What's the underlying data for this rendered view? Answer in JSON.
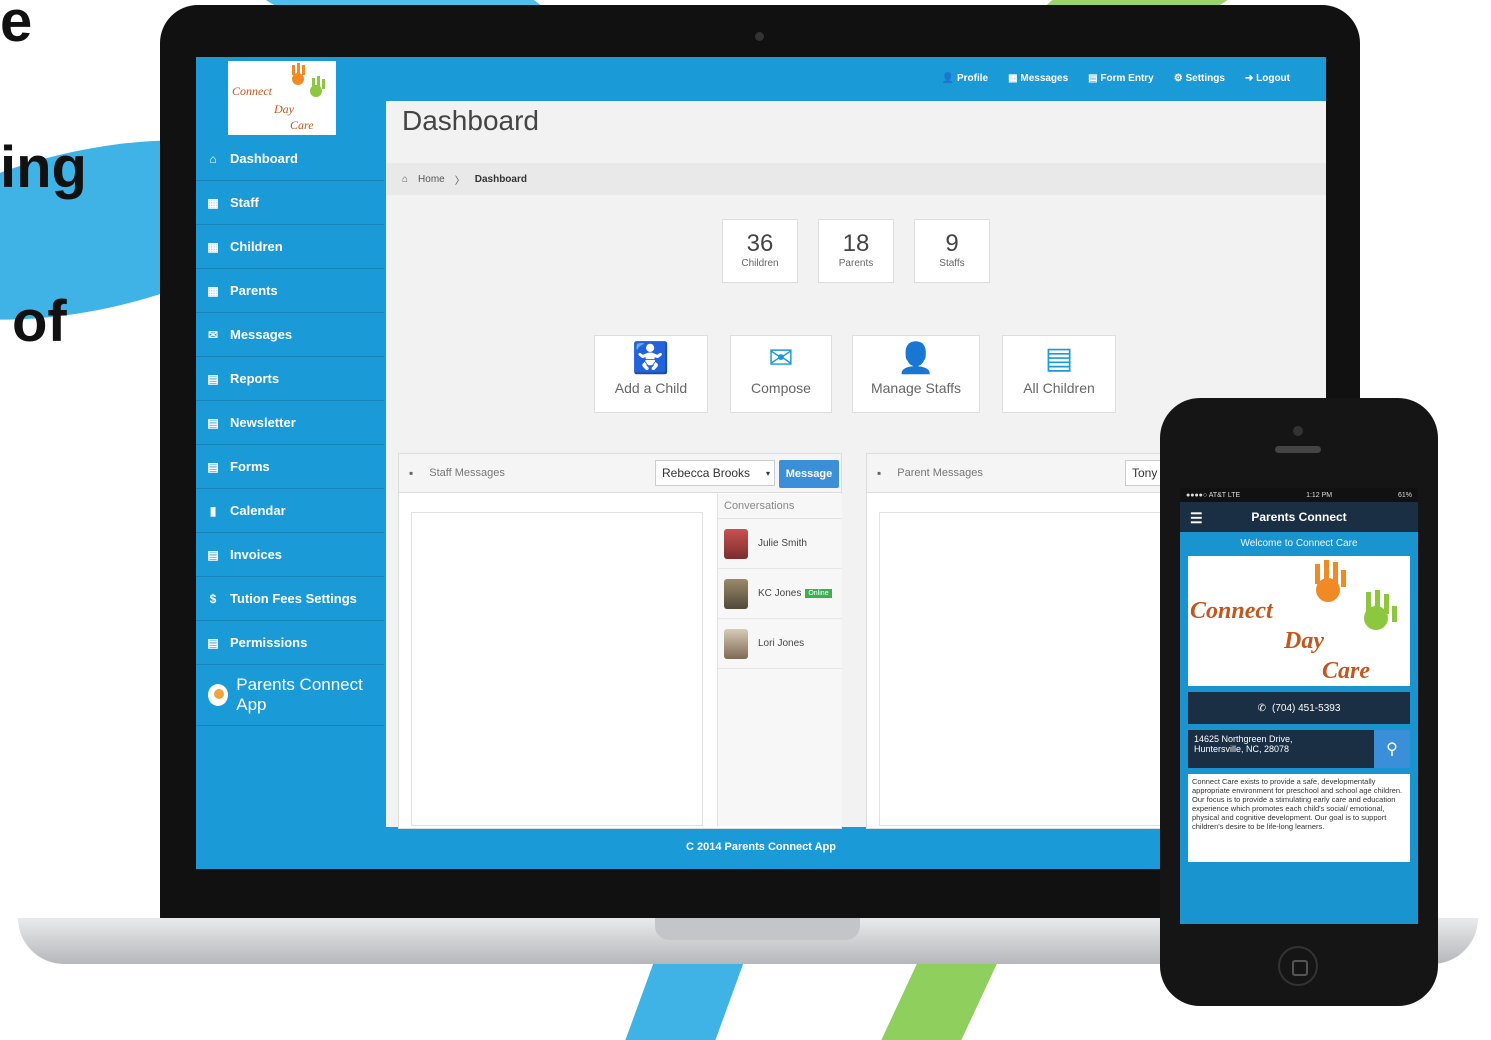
{
  "background_text": [
    "e",
    "ing",
    "of"
  ],
  "laptop": {
    "topnav": [
      "Profile",
      "Messages",
      "Form Entry",
      "Settings",
      "Logout"
    ],
    "logo_text": [
      "Connect",
      "Day",
      "Care"
    ],
    "sidebar": {
      "items": [
        {
          "icon": "home-icon",
          "label": "Dashboard"
        },
        {
          "icon": "list-icon",
          "label": "Staff"
        },
        {
          "icon": "list-icon",
          "label": "Children"
        },
        {
          "icon": "list-icon",
          "label": "Parents"
        },
        {
          "icon": "envelope-icon",
          "label": "Messages"
        },
        {
          "icon": "document-icon",
          "label": "Reports"
        },
        {
          "icon": "document-icon",
          "label": "Newsletter"
        },
        {
          "icon": "document-icon",
          "label": "Forms"
        },
        {
          "icon": "calendar-icon",
          "label": "Calendar"
        },
        {
          "icon": "document-icon",
          "label": "Invoices"
        },
        {
          "icon": "dollar-icon",
          "label": "Tution Fees Settings"
        },
        {
          "icon": "document-icon",
          "label": "Permissions"
        }
      ],
      "app_label": "Parents Connect App"
    },
    "page_title": "Dashboard",
    "breadcrumb": {
      "home": "Home",
      "sep": "〉",
      "current": "Dashboard"
    },
    "stats": [
      {
        "value": "36",
        "label": "Children"
      },
      {
        "value": "18",
        "label": "Parents"
      },
      {
        "value": "9",
        "label": "Staffs"
      }
    ],
    "actions": [
      {
        "icon": "add-child-icon",
        "label": "Add a Child"
      },
      {
        "icon": "compose-icon",
        "label": "Compose"
      },
      {
        "icon": "user-icon",
        "label": "Manage Staffs"
      },
      {
        "icon": "list-icon",
        "label": "All Children"
      }
    ],
    "staff_panel": {
      "title": "Staff Messages",
      "select_value": "Rebecca Brooks",
      "button": "Message",
      "conversations_title": "Conversations",
      "conversations": [
        {
          "name": "Julie Smith",
          "badge": ""
        },
        {
          "name": "KC Jones",
          "badge": "Online"
        },
        {
          "name": "Lori Jones",
          "badge": ""
        }
      ]
    },
    "parent_panel": {
      "title": "Parent Messages",
      "select_value": "Tony"
    },
    "footer": "C 2014 Parents Connect App"
  },
  "phone": {
    "status_left": "●●●●○ AT&T LTE",
    "status_time": "1:12 PM",
    "status_right": "61%",
    "title": "Parents Connect",
    "welcome": "Welcome to Connect Care",
    "logo_text": [
      "Connect",
      "Day",
      "Care"
    ],
    "phone_number": "(704) 451-5393",
    "address_line1": "14625 Northgreen Drive,",
    "address_line2": "Huntersville, NC, 28078",
    "description": "Connect Care exists to provide a safe, developmentally appropriate environment for preschool and school age children. Our focus is to provide a stimulating early care and education experience which promotes each child's social/ emotional, physical and cognitive development. Our goal is to support children's desire to be life-long learners."
  },
  "colors": {
    "brand_blue": "#1a9ad6",
    "dark_navy": "#1a2f44",
    "button_blue": "#3a8fd8",
    "online_green": "#37b24d"
  }
}
